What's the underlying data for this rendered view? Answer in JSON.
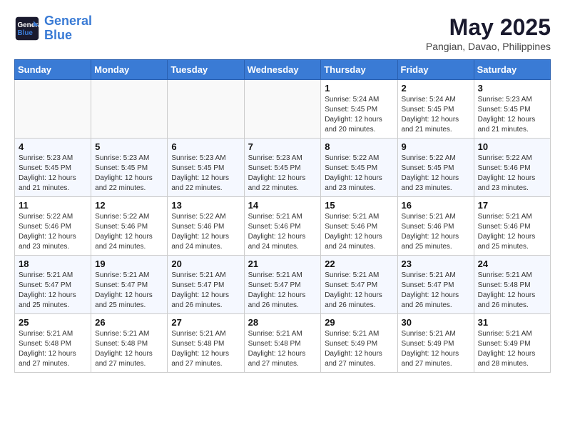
{
  "header": {
    "logo_line1": "General",
    "logo_line2": "Blue",
    "month": "May 2025",
    "location": "Pangian, Davao, Philippines"
  },
  "days_of_week": [
    "Sunday",
    "Monday",
    "Tuesday",
    "Wednesday",
    "Thursday",
    "Friday",
    "Saturday"
  ],
  "weeks": [
    [
      {
        "num": "",
        "info": ""
      },
      {
        "num": "",
        "info": ""
      },
      {
        "num": "",
        "info": ""
      },
      {
        "num": "",
        "info": ""
      },
      {
        "num": "1",
        "info": "Sunrise: 5:24 AM\nSunset: 5:45 PM\nDaylight: 12 hours\nand 20 minutes."
      },
      {
        "num": "2",
        "info": "Sunrise: 5:24 AM\nSunset: 5:45 PM\nDaylight: 12 hours\nand 21 minutes."
      },
      {
        "num": "3",
        "info": "Sunrise: 5:23 AM\nSunset: 5:45 PM\nDaylight: 12 hours\nand 21 minutes."
      }
    ],
    [
      {
        "num": "4",
        "info": "Sunrise: 5:23 AM\nSunset: 5:45 PM\nDaylight: 12 hours\nand 21 minutes."
      },
      {
        "num": "5",
        "info": "Sunrise: 5:23 AM\nSunset: 5:45 PM\nDaylight: 12 hours\nand 22 minutes."
      },
      {
        "num": "6",
        "info": "Sunrise: 5:23 AM\nSunset: 5:45 PM\nDaylight: 12 hours\nand 22 minutes."
      },
      {
        "num": "7",
        "info": "Sunrise: 5:23 AM\nSunset: 5:45 PM\nDaylight: 12 hours\nand 22 minutes."
      },
      {
        "num": "8",
        "info": "Sunrise: 5:22 AM\nSunset: 5:45 PM\nDaylight: 12 hours\nand 23 minutes."
      },
      {
        "num": "9",
        "info": "Sunrise: 5:22 AM\nSunset: 5:45 PM\nDaylight: 12 hours\nand 23 minutes."
      },
      {
        "num": "10",
        "info": "Sunrise: 5:22 AM\nSunset: 5:46 PM\nDaylight: 12 hours\nand 23 minutes."
      }
    ],
    [
      {
        "num": "11",
        "info": "Sunrise: 5:22 AM\nSunset: 5:46 PM\nDaylight: 12 hours\nand 23 minutes."
      },
      {
        "num": "12",
        "info": "Sunrise: 5:22 AM\nSunset: 5:46 PM\nDaylight: 12 hours\nand 24 minutes."
      },
      {
        "num": "13",
        "info": "Sunrise: 5:22 AM\nSunset: 5:46 PM\nDaylight: 12 hours\nand 24 minutes."
      },
      {
        "num": "14",
        "info": "Sunrise: 5:21 AM\nSunset: 5:46 PM\nDaylight: 12 hours\nand 24 minutes."
      },
      {
        "num": "15",
        "info": "Sunrise: 5:21 AM\nSunset: 5:46 PM\nDaylight: 12 hours\nand 24 minutes."
      },
      {
        "num": "16",
        "info": "Sunrise: 5:21 AM\nSunset: 5:46 PM\nDaylight: 12 hours\nand 25 minutes."
      },
      {
        "num": "17",
        "info": "Sunrise: 5:21 AM\nSunset: 5:46 PM\nDaylight: 12 hours\nand 25 minutes."
      }
    ],
    [
      {
        "num": "18",
        "info": "Sunrise: 5:21 AM\nSunset: 5:47 PM\nDaylight: 12 hours\nand 25 minutes."
      },
      {
        "num": "19",
        "info": "Sunrise: 5:21 AM\nSunset: 5:47 PM\nDaylight: 12 hours\nand 25 minutes."
      },
      {
        "num": "20",
        "info": "Sunrise: 5:21 AM\nSunset: 5:47 PM\nDaylight: 12 hours\nand 26 minutes."
      },
      {
        "num": "21",
        "info": "Sunrise: 5:21 AM\nSunset: 5:47 PM\nDaylight: 12 hours\nand 26 minutes."
      },
      {
        "num": "22",
        "info": "Sunrise: 5:21 AM\nSunset: 5:47 PM\nDaylight: 12 hours\nand 26 minutes."
      },
      {
        "num": "23",
        "info": "Sunrise: 5:21 AM\nSunset: 5:47 PM\nDaylight: 12 hours\nand 26 minutes."
      },
      {
        "num": "24",
        "info": "Sunrise: 5:21 AM\nSunset: 5:48 PM\nDaylight: 12 hours\nand 26 minutes."
      }
    ],
    [
      {
        "num": "25",
        "info": "Sunrise: 5:21 AM\nSunset: 5:48 PM\nDaylight: 12 hours\nand 27 minutes."
      },
      {
        "num": "26",
        "info": "Sunrise: 5:21 AM\nSunset: 5:48 PM\nDaylight: 12 hours\nand 27 minutes."
      },
      {
        "num": "27",
        "info": "Sunrise: 5:21 AM\nSunset: 5:48 PM\nDaylight: 12 hours\nand 27 minutes."
      },
      {
        "num": "28",
        "info": "Sunrise: 5:21 AM\nSunset: 5:48 PM\nDaylight: 12 hours\nand 27 minutes."
      },
      {
        "num": "29",
        "info": "Sunrise: 5:21 AM\nSunset: 5:49 PM\nDaylight: 12 hours\nand 27 minutes."
      },
      {
        "num": "30",
        "info": "Sunrise: 5:21 AM\nSunset: 5:49 PM\nDaylight: 12 hours\nand 27 minutes."
      },
      {
        "num": "31",
        "info": "Sunrise: 5:21 AM\nSunset: 5:49 PM\nDaylight: 12 hours\nand 28 minutes."
      }
    ]
  ]
}
